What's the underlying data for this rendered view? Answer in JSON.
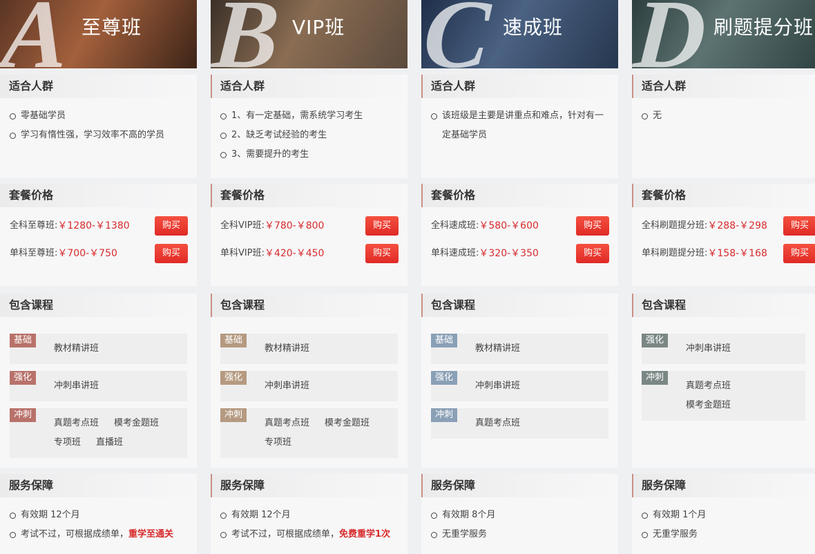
{
  "columns": [
    {
      "letter": "A",
      "title": "至尊班",
      "hero_colors": [
        "#5a3525",
        "#a3603c",
        "#3d2418"
      ],
      "tag_color": "#b8726a",
      "suitable": {
        "heading": "适合人群",
        "items": [
          "零基础学员",
          "学习有惰性强，学习效率不高的学员"
        ]
      },
      "price": {
        "heading": "套餐价格",
        "rows": [
          {
            "name": "全科至尊班:",
            "value": "￥1280-￥1380",
            "buy": "购买"
          },
          {
            "name": "单科至尊班:",
            "value": "￥700-￥750",
            "buy": "购买"
          }
        ]
      },
      "courses": {
        "heading": "包含课程",
        "rows": [
          {
            "tag": "基础",
            "items": [
              "教材精讲班"
            ]
          },
          {
            "tag": "强化",
            "items": [
              "冲刺串讲班"
            ]
          },
          {
            "tag": "冲刺",
            "items": [
              "真题考点班",
              "模考金题班",
              "专项班",
              "直播班"
            ]
          }
        ]
      },
      "service": {
        "heading": "服务保障",
        "items": [
          {
            "text": "有效期 12个月",
            "hl": ""
          },
          {
            "text": "考试不过，可根据成绩单，",
            "hl": "重学至通关"
          }
        ]
      }
    },
    {
      "letter": "B",
      "title": "VIP班",
      "hero_colors": [
        "#3b3028",
        "#8a6d53",
        "#5b4a3c"
      ],
      "tag_color": "#b59a80",
      "suitable": {
        "heading": "适合人群",
        "items": [
          "1、有一定基础，需系统学习考生",
          "2、缺乏考试经验的考生",
          "3、需要提升的考生"
        ]
      },
      "price": {
        "heading": "套餐价格",
        "rows": [
          {
            "name": "全科VIP班:",
            "value": "￥780-￥800",
            "buy": "购买"
          },
          {
            "name": "单科VIP班:",
            "value": "￥420-￥450",
            "buy": "购买"
          }
        ]
      },
      "courses": {
        "heading": "包含课程",
        "rows": [
          {
            "tag": "基础",
            "items": [
              "教材精讲班"
            ]
          },
          {
            "tag": "强化",
            "items": [
              "冲刺串讲班"
            ]
          },
          {
            "tag": "冲刺",
            "items": [
              "真题考点班",
              "模考金题班",
              "专项班"
            ]
          }
        ]
      },
      "service": {
        "heading": "服务保障",
        "items": [
          {
            "text": "有效期 12个月",
            "hl": ""
          },
          {
            "text": "考试不过，可根据成绩单，",
            "hl": "免费重学1次"
          }
        ]
      }
    },
    {
      "letter": "C",
      "title": "速成班",
      "hero_colors": [
        "#1f2f4a",
        "#4b6283",
        "#26374f"
      ],
      "tag_color": "#8aa0b6",
      "suitable": {
        "heading": "适合人群",
        "items": [
          "该班级是主要是讲重点和难点，针对有一定基础学员"
        ]
      },
      "price": {
        "heading": "套餐价格",
        "rows": [
          {
            "name": "全科速成班:",
            "value": "￥580-￥600",
            "buy": "购买"
          },
          {
            "name": "单科速成班:",
            "value": "￥320-￥350",
            "buy": "购买"
          }
        ]
      },
      "courses": {
        "heading": "包含课程",
        "rows": [
          {
            "tag": "基础",
            "items": [
              "教材精讲班"
            ]
          },
          {
            "tag": "强化",
            "items": [
              "冲刺串讲班"
            ]
          },
          {
            "tag": "冲刺",
            "items": [
              "真题考点班"
            ]
          }
        ]
      },
      "service": {
        "heading": "服务保障",
        "items": [
          {
            "text": "有效期 8个月",
            "hl": ""
          },
          {
            "text": "无重学服务",
            "hl": ""
          }
        ]
      }
    },
    {
      "letter": "D",
      "title": "刷题提分班",
      "hero_colors": [
        "#2c3f3e",
        "#5d7372",
        "#314544"
      ],
      "tag_color": "#7a8785",
      "suitable": {
        "heading": "适合人群",
        "items": [
          "无"
        ]
      },
      "price": {
        "heading": "套餐价格",
        "rows": [
          {
            "name": "全科刷题提分班:",
            "value": "￥288-￥298",
            "buy": "购买"
          },
          {
            "name": "单科刷题提分班:",
            "value": "￥158-￥168",
            "buy": "购买"
          }
        ]
      },
      "courses": {
        "heading": "包含课程",
        "rows": [
          {
            "tag": "强化",
            "items": [
              "冲刺串讲班"
            ]
          },
          {
            "tag": "冲刺",
            "items": [
              "真题考点班",
              "模考金题班"
            ]
          }
        ]
      },
      "service": {
        "heading": "服务保障",
        "items": [
          {
            "text": "有效期 1个月",
            "hl": ""
          },
          {
            "text": "无重学服务",
            "hl": ""
          }
        ]
      }
    }
  ]
}
